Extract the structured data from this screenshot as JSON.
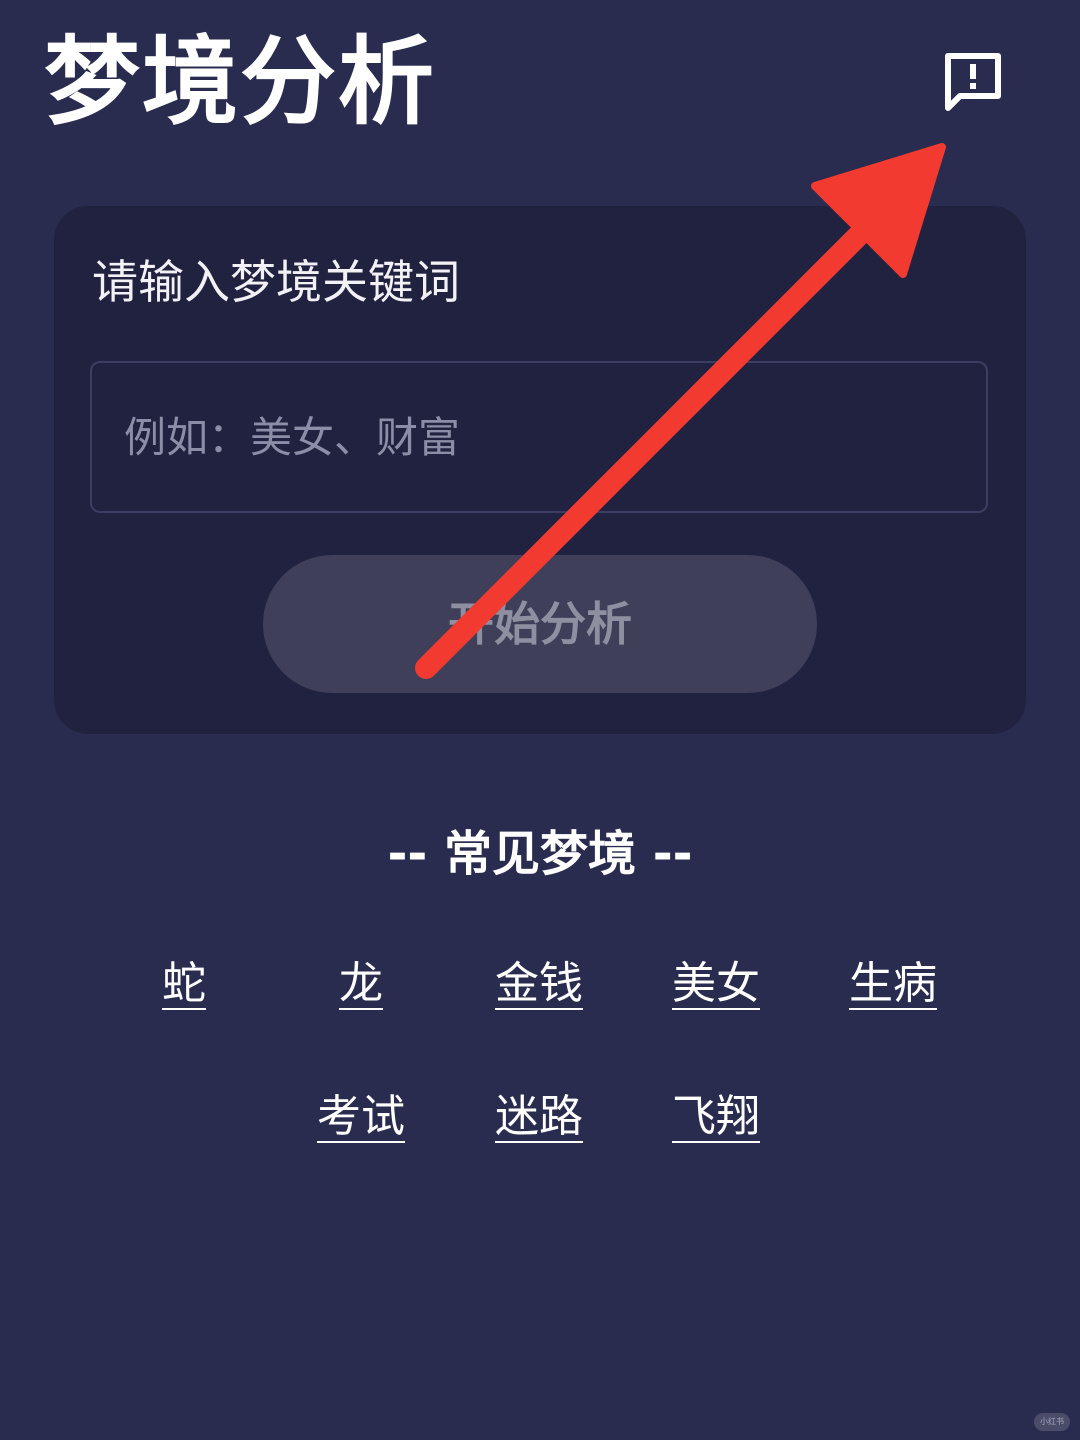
{
  "header": {
    "title": "梦境分析",
    "feedback_icon": "feedback-icon"
  },
  "search_card": {
    "label": "请输入梦境关键词",
    "input_placeholder": "例如：美女、财富",
    "input_value": "",
    "button_label": "开始分析"
  },
  "common_dreams": {
    "title": "-- 常见梦境 --",
    "tags": [
      "蛇",
      "龙",
      "金钱",
      "美女",
      "生病",
      "考试",
      "迷路",
      "飞翔"
    ]
  },
  "watermark": "小红书",
  "colors": {
    "background": "#292c4e",
    "card": "#212240",
    "button": "#3f3f59",
    "annotation_arrow": "#f23a30"
  }
}
